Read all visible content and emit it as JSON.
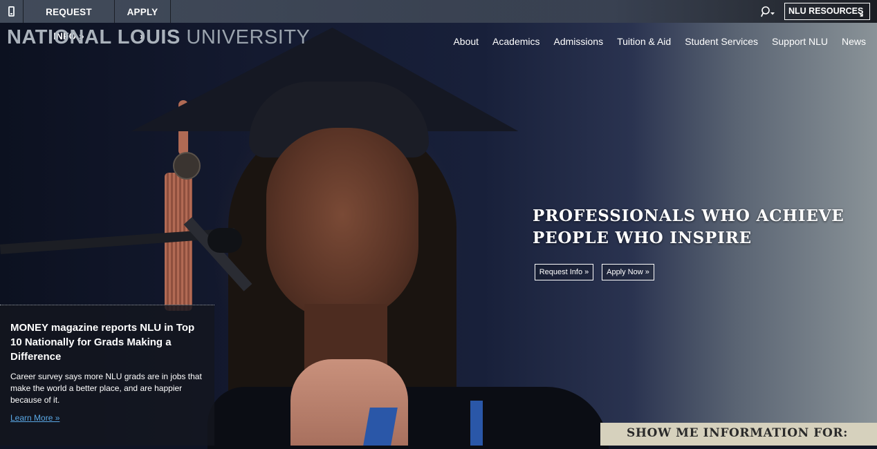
{
  "topbar": {
    "mobile_icon": "mobile-phone-icon",
    "request_info": "REQUEST INFO »",
    "apply": "APPLY »",
    "search_icon": "search-icon",
    "resources": "NLU RESOURCES",
    "resources_icon": "arrow-down-right-icon"
  },
  "logo": {
    "part1": "NATIONAL LOUIS",
    "part2": "UNIVERSITY"
  },
  "nav": {
    "items": [
      "About",
      "Academics",
      "Admissions",
      "Tuition & Aid",
      "Student Services",
      "Support NLU",
      "News"
    ]
  },
  "hero": {
    "line1": "PROFESSIONALS WHO ACHIEVE",
    "line2": "PEOPLE WHO INSPIRE",
    "request_button": "Request Info »",
    "apply_button": "Apply Now »"
  },
  "news": {
    "title": "MONEY magazine reports NLU in Top 10 Nationally for Grads Making a Difference",
    "body": "Career survey says more NLU grads are in jobs that make the world a better place, and are happier because of it.",
    "link": "Learn More »"
  },
  "showme": {
    "label": "SHOW ME INFORMATION FOR:"
  },
  "colors": {
    "accent_link": "#5aa8e6",
    "showme_bg": "#d6d1bd"
  }
}
